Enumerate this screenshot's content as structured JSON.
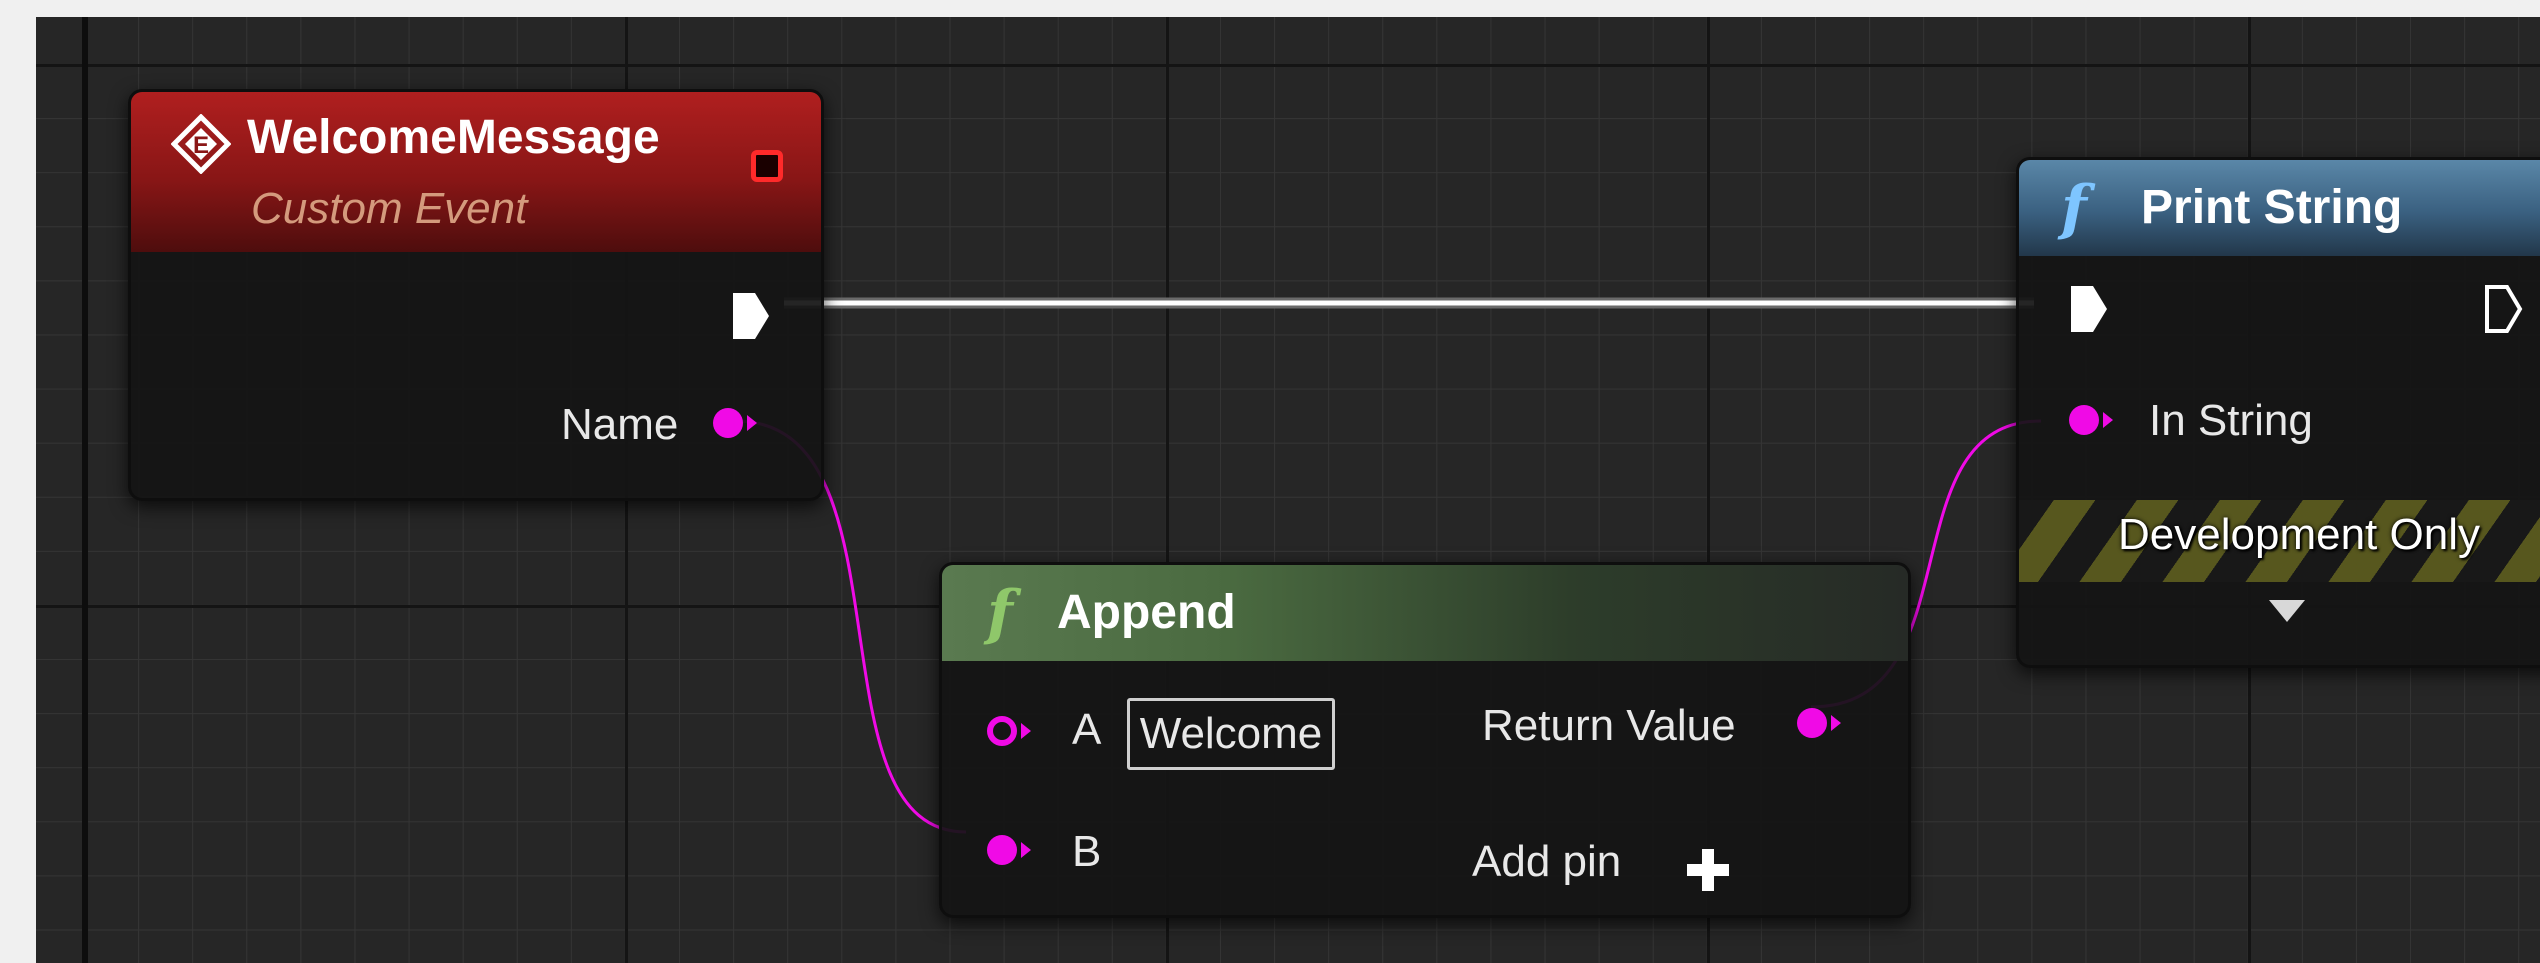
{
  "event_node": {
    "title": "WelcomeMessage",
    "subtitle": "Custom Event",
    "output_label": "Name"
  },
  "append_node": {
    "title": "Append",
    "pin_a_label": "A",
    "pin_a_value": "Welcome",
    "pin_b_label": "B",
    "return_label": "Return Value",
    "add_pin_label": "Add pin"
  },
  "print_node": {
    "title": "Print String",
    "in_string_label": "In String",
    "dev_only_label": "Development Only"
  },
  "icons": {
    "function": "f",
    "event": "custom-event-icon",
    "expand": "chevron-down-icon"
  },
  "colors": {
    "string_pin": "#f00ae6",
    "exec_wire": "#ffffff",
    "event_header": "#881616",
    "function_header": "#3a6080",
    "pure_function_header": "#4a6a40"
  }
}
